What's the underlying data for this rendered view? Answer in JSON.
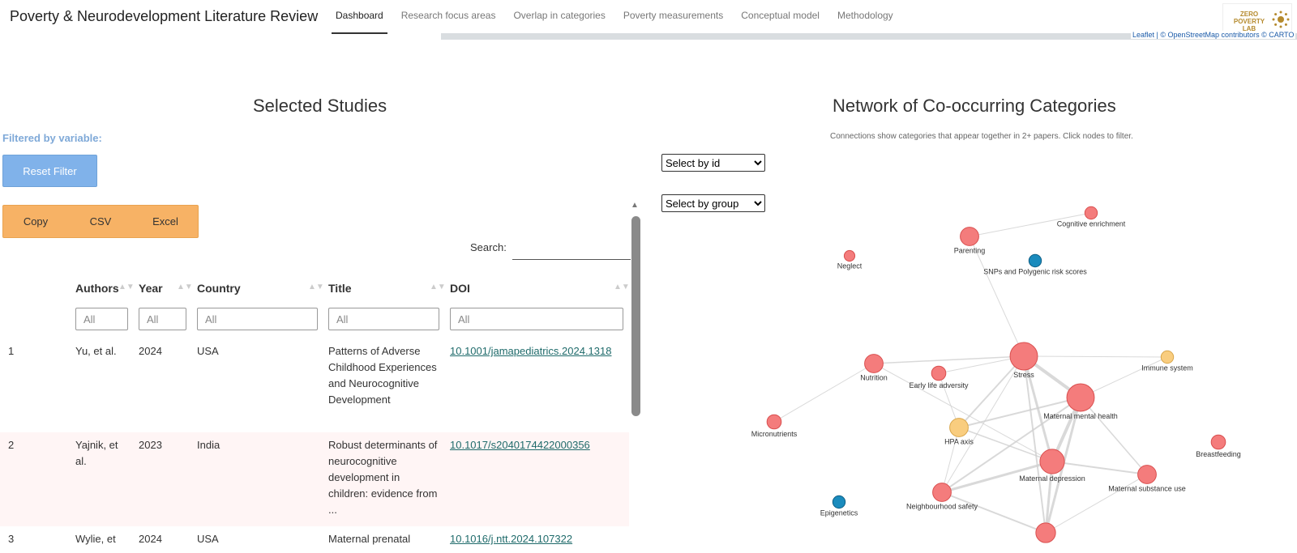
{
  "app": {
    "title": "Poverty & Neurodevelopment Literature Review",
    "logo_text": "ZERO POVERTY LAB"
  },
  "nav": {
    "items": [
      {
        "label": "Dashboard",
        "active": true
      },
      {
        "label": "Research focus areas"
      },
      {
        "label": "Overlap in categories"
      },
      {
        "label": "Poverty measurements"
      },
      {
        "label": "Conceptual model"
      },
      {
        "label": "Methodology"
      }
    ]
  },
  "map": {
    "attribution_leaflet": "Leaflet",
    "attribution_osm": "| © OpenStreetMap contributors © CARTO"
  },
  "studies": {
    "title": "Selected Studies",
    "filtered_label": "Filtered by variable:",
    "reset_label": "Reset Filter",
    "export": {
      "copy": "Copy",
      "csv": "CSV",
      "excel": "Excel"
    },
    "search_label": "Search:",
    "columns": {
      "authors": "Authors",
      "year": "Year",
      "country": "Country",
      "title": "Title",
      "doi": "DOI"
    },
    "filter_placeholder": "All",
    "rows": [
      {
        "n": "1",
        "authors": "Yu, et al.",
        "year": "2024",
        "country": "USA",
        "title": "Patterns of Adverse Childhood Experiences and Neurocognitive Development",
        "doi": "10.1001/jamapediatrics.2024.1318"
      },
      {
        "n": "2",
        "authors": "Yajnik, et al.",
        "year": "2023",
        "country": "India",
        "title": "Robust determinants of neurocognitive development in children: evidence from ...",
        "doi": "10.1017/s2040174422000356"
      },
      {
        "n": "3",
        "authors": "Wylie, et",
        "year": "2024",
        "country": "USA",
        "title": "Maternal prenatal",
        "doi": "10.1016/j.ntt.2024.107322"
      }
    ]
  },
  "network": {
    "title": "Network of Co-occurring Categories",
    "subtitle": "Connections show categories that appear together in 2+ papers. Click nodes to filter.",
    "select_id": "Select by id",
    "select_group": "Select by group",
    "colors": {
      "red": "#f47c7c",
      "yellow": "#f9cd7f",
      "blue": "#1a8bbd",
      "edge": "#d0d0d0"
    },
    "nodes": [
      {
        "id": "cog",
        "label": "Cognitive enrichment",
        "group": "red",
        "size": 1
      },
      {
        "id": "parenting",
        "label": "Parenting",
        "group": "red",
        "size": 2
      },
      {
        "id": "snp",
        "label": "SNPs and Polygenic risk scores",
        "group": "blue",
        "size": 1
      },
      {
        "id": "neglect",
        "label": "Neglect",
        "group": "red",
        "size": 0.7
      },
      {
        "id": "stress",
        "label": "Stress",
        "group": "red",
        "size": 3.5
      },
      {
        "id": "immune",
        "label": "Immune system",
        "group": "yellow",
        "size": 1
      },
      {
        "id": "nutrition",
        "label": "Nutrition",
        "group": "red",
        "size": 2
      },
      {
        "id": "early",
        "label": "Early life adversity",
        "group": "red",
        "size": 1.3
      },
      {
        "id": "mmh",
        "label": "Maternal mental health",
        "group": "red",
        "size": 3.5
      },
      {
        "id": "micro",
        "label": "Micronutrients",
        "group": "red",
        "size": 1.3
      },
      {
        "id": "hpa",
        "label": "HPA axis",
        "group": "yellow",
        "size": 2
      },
      {
        "id": "bf",
        "label": "Breastfeeding",
        "group": "red",
        "size": 1.3
      },
      {
        "id": "md",
        "label": "Maternal depression",
        "group": "red",
        "size": 3
      },
      {
        "id": "msu",
        "label": "Maternal substance use",
        "group": "red",
        "size": 2
      },
      {
        "id": "epi",
        "label": "Epigenetics",
        "group": "blue",
        "size": 1
      },
      {
        "id": "nsafe",
        "label": "Neighbourhood safety",
        "group": "red",
        "size": 2
      },
      {
        "id": "bottom",
        "label": "",
        "group": "red",
        "size": 2.2
      }
    ],
    "edges": [
      [
        "parenting",
        "stress",
        1
      ],
      [
        "parenting",
        "cog",
        1
      ],
      [
        "nutrition",
        "stress",
        1.5
      ],
      [
        "early",
        "stress",
        1
      ],
      [
        "stress",
        "mmh",
        4
      ],
      [
        "stress",
        "md",
        3
      ],
      [
        "stress",
        "hpa",
        2
      ],
      [
        "stress",
        "immune",
        1
      ],
      [
        "stress",
        "nsafe",
        1
      ],
      [
        "mmh",
        "md",
        4
      ],
      [
        "mmh",
        "hpa",
        2
      ],
      [
        "mmh",
        "immune",
        1
      ],
      [
        "mmh",
        "msu",
        1.5
      ],
      [
        "mmh",
        "nsafe",
        2
      ],
      [
        "md",
        "msu",
        2
      ],
      [
        "md",
        "nsafe",
        3
      ],
      [
        "md",
        "hpa",
        1.5
      ],
      [
        "nutrition",
        "micro",
        1
      ],
      [
        "hpa",
        "nsafe",
        1
      ],
      [
        "nsafe",
        "bottom",
        2
      ],
      [
        "md",
        "bottom",
        3
      ],
      [
        "mmh",
        "bottom",
        3
      ],
      [
        "stress",
        "bottom",
        2
      ],
      [
        "early",
        "hpa",
        1
      ],
      [
        "nutrition",
        "md",
        1
      ],
      [
        "msu",
        "bottom",
        1
      ]
    ]
  }
}
